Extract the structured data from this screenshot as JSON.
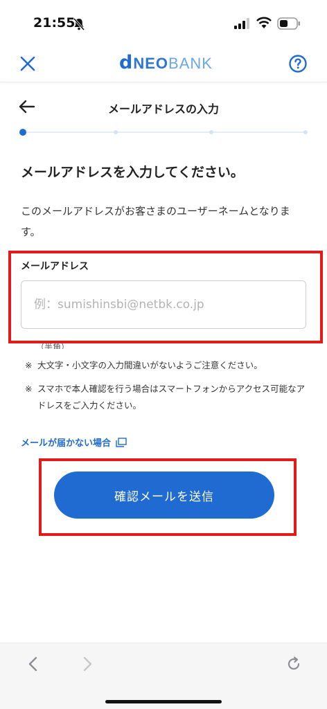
{
  "status_bar": {
    "time": "21:55",
    "icons": [
      "bell-slash-icon",
      "cellular-signal-icon",
      "wifi-icon",
      "battery-icon"
    ]
  },
  "app_header": {
    "logo_d": "d",
    "logo_neo": "NEO",
    "logo_bank": "BANK",
    "close_icon": "close-icon",
    "help_icon": "question-circle-icon"
  },
  "page_header": {
    "title": "メールアドレスの入力",
    "back_icon": "arrow-left-icon"
  },
  "progress": {
    "current_step": 1,
    "total_steps": 4
  },
  "heading": "メールアドレスを入力してください。",
  "description": "このメールアドレスがお客さまのユーザーネームとなります。",
  "email_field": {
    "label": "メールアドレス",
    "value": "",
    "placeholder": "例：sumishinsbi@netbk.co.jp",
    "hint": "（半角）"
  },
  "notes": [
    {
      "mark": "※",
      "text": "大文字・小文字の入力間違いがないようご注意ください。"
    },
    {
      "mark": "※",
      "text": "スマホで本人確認を行う場合はスマートフォンからアクセス可能なアドレスをご入力ください。"
    }
  ],
  "help_link": {
    "label": "メールが届かない場合",
    "icon": "external-window-icon"
  },
  "submit_button": {
    "label": "確認メールを送信"
  },
  "browser_bar": {
    "icons": [
      "chevron-left-icon",
      "chevron-right-icon",
      "reload-icon"
    ]
  },
  "colors": {
    "brand_blue": "#1f6bd1",
    "highlight_red": "#e21a1a",
    "text": "#222222",
    "border": "#cfcfcf"
  }
}
